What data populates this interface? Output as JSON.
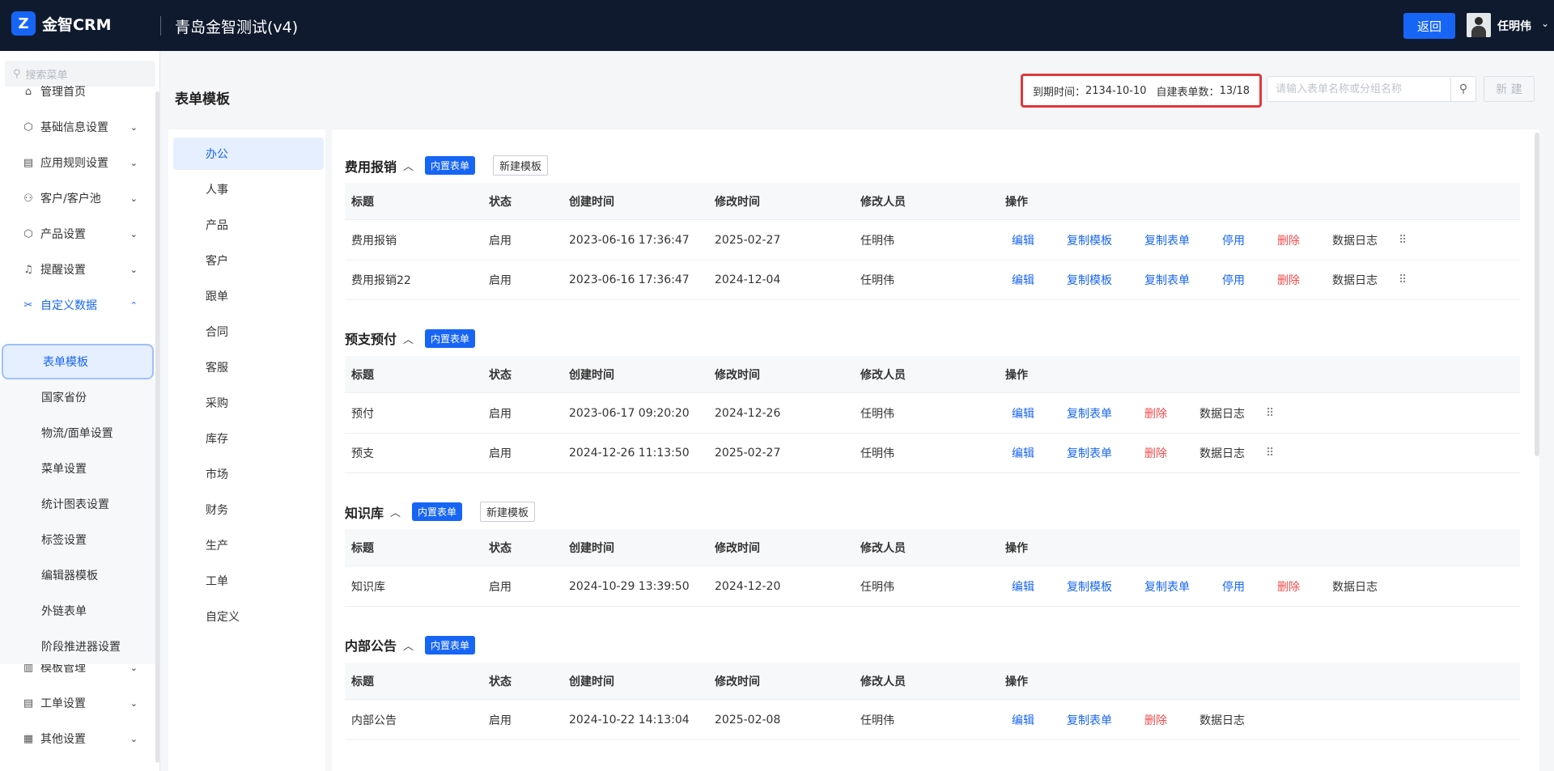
{
  "brand": {
    "logo_glyph": "Z",
    "name": "金智CRM"
  },
  "app_title": "青岛金智测试(v4)",
  "header": {
    "back_label": "返回",
    "user_name": "任明伟",
    "user_caret": "⌄"
  },
  "sidebar": {
    "search_placeholder": "搜索菜单",
    "items": [
      {
        "label": "管理首页",
        "icon": "⌂"
      },
      {
        "label": "基础信息设置",
        "icon": "⬡",
        "caret": "⌄"
      },
      {
        "label": "应用规则设置",
        "icon": "▤",
        "caret": "⌄"
      },
      {
        "label": "客户/客户池",
        "icon": "⚇",
        "caret": "⌄"
      },
      {
        "label": "产品设置",
        "icon": "⬡",
        "caret": "⌄"
      },
      {
        "label": "提醒设置",
        "icon": "♫",
        "caret": "⌄"
      },
      {
        "label": "自定义数据",
        "icon": "✂",
        "caret": "⌃"
      },
      {
        "label": "模板管理",
        "icon": "▥",
        "caret": "⌄"
      },
      {
        "label": "工单设置",
        "icon": "▤",
        "caret": "⌄"
      },
      {
        "label": "其他设置",
        "icon": "▦",
        "caret": "⌄"
      }
    ],
    "sub_items": [
      "表单模板",
      "国家省份",
      "物流/面单设置",
      "菜单设置",
      "统计图表设置",
      "标签设置",
      "编辑器模板",
      "外链表单",
      "阶段推进器设置"
    ]
  },
  "page": {
    "title": "表单模板",
    "expiry_label": "到期时间：",
    "expiry_value": "2134-10-10",
    "count_label": "自建表单数：",
    "count_value": "13/18",
    "search_placeholder": "请输入表单名称或分组名称",
    "new_label": "新 建"
  },
  "categories": [
    "办公",
    "人事",
    "产品",
    "客户",
    "跟单",
    "合同",
    "客服",
    "采购",
    "库存",
    "市场",
    "财务",
    "生产",
    "工单",
    "自定义"
  ],
  "table_columns": [
    "标题",
    "状态",
    "创建时间",
    "修改时间",
    "修改人员",
    "操作"
  ],
  "sections": [
    {
      "title": "费用报销",
      "badge": "内置表单",
      "new_template": "新建模板",
      "rows": [
        {
          "title": "费用报销",
          "status": "启用",
          "created": "2023-06-16 17:36:47",
          "modified": "2025-02-27",
          "modifier": "任明伟",
          "ops": [
            "编辑",
            "复制模板",
            "复制表单",
            "停用",
            "删除",
            "数据日志"
          ]
        },
        {
          "title": "费用报销22",
          "status": "启用",
          "created": "2023-06-16 17:36:47",
          "modified": "2024-12-04",
          "modifier": "任明伟",
          "ops": [
            "编辑",
            "复制模板",
            "复制表单",
            "停用",
            "删除",
            "数据日志"
          ]
        }
      ]
    },
    {
      "title": "预支预付",
      "badge": "内置表单",
      "rows": [
        {
          "title": "预付",
          "status": "启用",
          "created": "2023-06-17 09:20:20",
          "modified": "2024-12-26",
          "modifier": "任明伟",
          "ops": [
            "编辑",
            "复制表单",
            "删除",
            "数据日志"
          ]
        },
        {
          "title": "预支",
          "status": "启用",
          "created": "2024-12-26 11:13:50",
          "modified": "2025-02-27",
          "modifier": "任明伟",
          "ops": [
            "编辑",
            "复制表单",
            "删除",
            "数据日志"
          ]
        }
      ]
    },
    {
      "title": "知识库",
      "badge": "内置表单",
      "new_template": "新建模板",
      "rows": [
        {
          "title": "知识库",
          "status": "启用",
          "created": "2024-10-29 13:39:50",
          "modified": "2024-12-20",
          "modifier": "任明伟",
          "ops": [
            "编辑",
            "复制模板",
            "复制表单",
            "停用",
            "删除",
            "数据日志"
          ]
        }
      ]
    },
    {
      "title": "内部公告",
      "badge": "内置表单",
      "rows": [
        {
          "title": "内部公告",
          "status": "启用",
          "created": "2024-10-22 14:13:04",
          "modified": "2025-02-08",
          "modifier": "任明伟",
          "ops": [
            "编辑",
            "复制表单",
            "删除",
            "数据日志"
          ]
        }
      ]
    }
  ],
  "colors": {
    "accent": "#1765f5",
    "danger": "#f04b4b",
    "topbar": "#0f1a2e",
    "highlight_border": "#e0383a"
  }
}
